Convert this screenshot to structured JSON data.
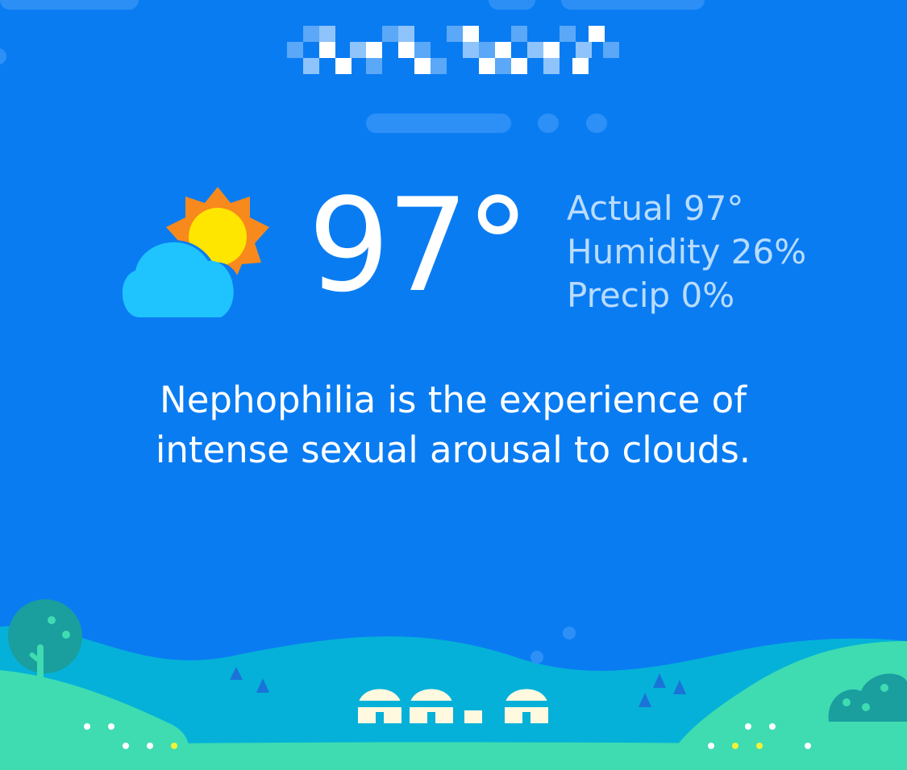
{
  "weather": {
    "temperature": "97°",
    "icon": "partly-sunny-icon",
    "details": [
      "Actual 97°",
      "Humidity 26%",
      "Precip 0%"
    ]
  },
  "fact": {
    "text": "Nephophilia is the experience of intense sexual arousal to clouds."
  },
  "colors": {
    "background": "#0a7cf2",
    "text": "#ffffff",
    "secondary_text": "#b9dcff",
    "hill_dark": "#05b1d8",
    "hill_light": "#3fdcb1",
    "tree": "#1a9e9e",
    "sun": "#ffe600",
    "sun_rays": "#f8891c",
    "cloud": "#1fc4ff"
  }
}
